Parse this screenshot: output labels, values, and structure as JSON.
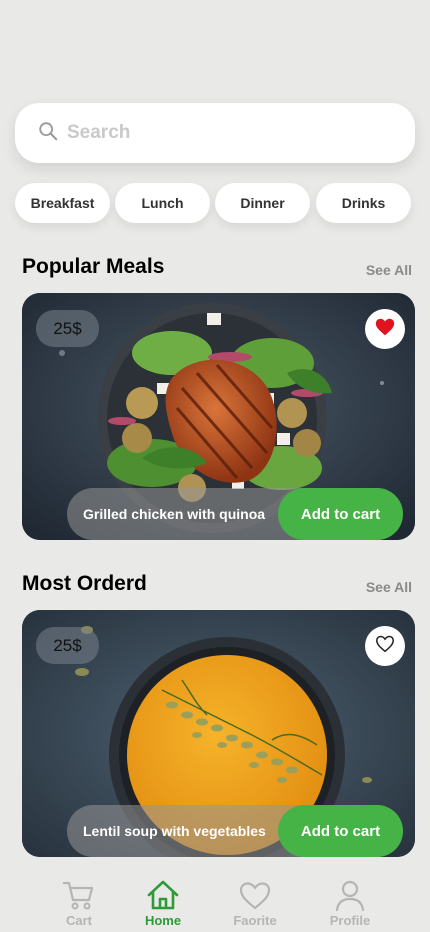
{
  "search": {
    "placeholder": "Search"
  },
  "categories": [
    "Breakfast",
    "Lunch",
    "Dinner",
    "Drinks"
  ],
  "sections": {
    "popular": {
      "title": "Popular Meals",
      "see_all": "See All"
    },
    "most_ordered": {
      "title": "Most Orderd",
      "see_all": "See All"
    }
  },
  "cards": [
    {
      "price": "25$",
      "name": "Grilled chicken with quinoa",
      "add_label": "Add to cart",
      "favorited": true
    },
    {
      "price": "25$",
      "name": "Lentil soup with vegetables",
      "add_label": "Add to cart",
      "favorited": false
    }
  ],
  "nav": {
    "cart": "Cart",
    "home": "Home",
    "favorite": "Faorite",
    "profile": "Profile"
  },
  "colors": {
    "accent": "#46b346",
    "nav_active": "#2f9a3a",
    "heart": "#e0141e",
    "background": "#e9e9e7"
  }
}
